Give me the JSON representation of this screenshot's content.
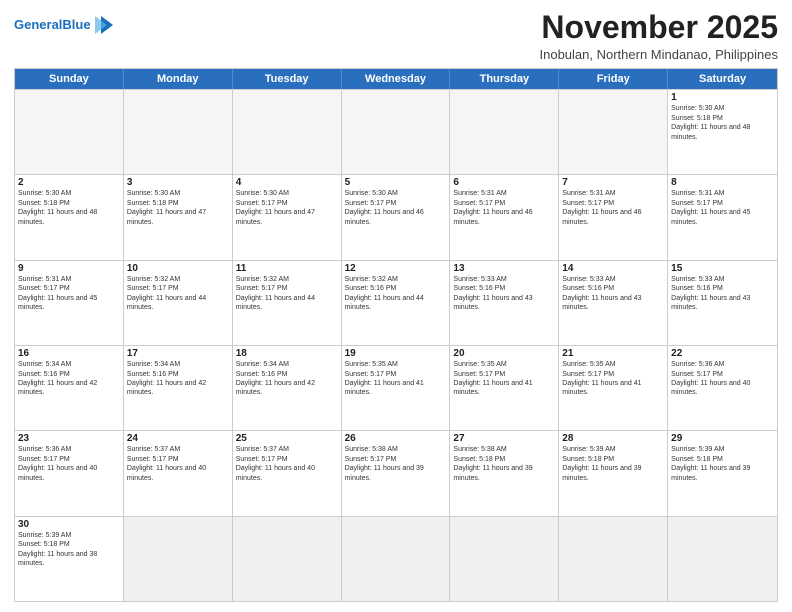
{
  "header": {
    "logo_general": "General",
    "logo_blue": "Blue",
    "month_title": "November 2025",
    "subtitle": "Inobulan, Northern Mindanao, Philippines"
  },
  "days_of_week": [
    "Sunday",
    "Monday",
    "Tuesday",
    "Wednesday",
    "Thursday",
    "Friday",
    "Saturday"
  ],
  "weeks": [
    [
      {
        "day": "",
        "empty": true
      },
      {
        "day": "",
        "empty": true
      },
      {
        "day": "",
        "empty": true
      },
      {
        "day": "",
        "empty": true
      },
      {
        "day": "",
        "empty": true
      },
      {
        "day": "",
        "empty": true
      },
      {
        "day": "1",
        "sunrise": "5:30 AM",
        "sunset": "5:18 PM",
        "daylight": "11 hours and 48 minutes."
      }
    ],
    [
      {
        "day": "2",
        "sunrise": "5:30 AM",
        "sunset": "5:18 PM",
        "daylight": "11 hours and 48 minutes."
      },
      {
        "day": "3",
        "sunrise": "5:30 AM",
        "sunset": "5:18 PM",
        "daylight": "11 hours and 47 minutes."
      },
      {
        "day": "4",
        "sunrise": "5:30 AM",
        "sunset": "5:17 PM",
        "daylight": "11 hours and 47 minutes."
      },
      {
        "day": "5",
        "sunrise": "5:30 AM",
        "sunset": "5:17 PM",
        "daylight": "11 hours and 46 minutes."
      },
      {
        "day": "6",
        "sunrise": "5:31 AM",
        "sunset": "5:17 PM",
        "daylight": "11 hours and 46 minutes."
      },
      {
        "day": "7",
        "sunrise": "5:31 AM",
        "sunset": "5:17 PM",
        "daylight": "11 hours and 46 minutes."
      },
      {
        "day": "8",
        "sunrise": "5:31 AM",
        "sunset": "5:17 PM",
        "daylight": "11 hours and 45 minutes."
      }
    ],
    [
      {
        "day": "9",
        "sunrise": "5:31 AM",
        "sunset": "5:17 PM",
        "daylight": "11 hours and 45 minutes."
      },
      {
        "day": "10",
        "sunrise": "5:32 AM",
        "sunset": "5:17 PM",
        "daylight": "11 hours and 44 minutes."
      },
      {
        "day": "11",
        "sunrise": "5:32 AM",
        "sunset": "5:17 PM",
        "daylight": "11 hours and 44 minutes."
      },
      {
        "day": "12",
        "sunrise": "5:32 AM",
        "sunset": "5:16 PM",
        "daylight": "11 hours and 44 minutes."
      },
      {
        "day": "13",
        "sunrise": "5:33 AM",
        "sunset": "5:16 PM",
        "daylight": "11 hours and 43 minutes."
      },
      {
        "day": "14",
        "sunrise": "5:33 AM",
        "sunset": "5:16 PM",
        "daylight": "11 hours and 43 minutes."
      },
      {
        "day": "15",
        "sunrise": "5:33 AM",
        "sunset": "5:16 PM",
        "daylight": "11 hours and 43 minutes."
      }
    ],
    [
      {
        "day": "16",
        "sunrise": "5:34 AM",
        "sunset": "5:16 PM",
        "daylight": "11 hours and 42 minutes."
      },
      {
        "day": "17",
        "sunrise": "5:34 AM",
        "sunset": "5:16 PM",
        "daylight": "11 hours and 42 minutes."
      },
      {
        "day": "18",
        "sunrise": "5:34 AM",
        "sunset": "5:16 PM",
        "daylight": "11 hours and 42 minutes."
      },
      {
        "day": "19",
        "sunrise": "5:35 AM",
        "sunset": "5:17 PM",
        "daylight": "11 hours and 41 minutes."
      },
      {
        "day": "20",
        "sunrise": "5:35 AM",
        "sunset": "5:17 PM",
        "daylight": "11 hours and 41 minutes."
      },
      {
        "day": "21",
        "sunrise": "5:35 AM",
        "sunset": "5:17 PM",
        "daylight": "11 hours and 41 minutes."
      },
      {
        "day": "22",
        "sunrise": "5:36 AM",
        "sunset": "5:17 PM",
        "daylight": "11 hours and 40 minutes."
      }
    ],
    [
      {
        "day": "23",
        "sunrise": "5:36 AM",
        "sunset": "5:17 PM",
        "daylight": "11 hours and 40 minutes."
      },
      {
        "day": "24",
        "sunrise": "5:37 AM",
        "sunset": "5:17 PM",
        "daylight": "11 hours and 40 minutes."
      },
      {
        "day": "25",
        "sunrise": "5:37 AM",
        "sunset": "5:17 PM",
        "daylight": "11 hours and 40 minutes."
      },
      {
        "day": "26",
        "sunrise": "5:38 AM",
        "sunset": "5:17 PM",
        "daylight": "11 hours and 39 minutes."
      },
      {
        "day": "27",
        "sunrise": "5:38 AM",
        "sunset": "5:18 PM",
        "daylight": "11 hours and 39 minutes."
      },
      {
        "day": "28",
        "sunrise": "5:39 AM",
        "sunset": "5:18 PM",
        "daylight": "11 hours and 39 minutes."
      },
      {
        "day": "29",
        "sunrise": "5:39 AM",
        "sunset": "5:18 PM",
        "daylight": "11 hours and 39 minutes."
      }
    ],
    [
      {
        "day": "30",
        "sunrise": "5:39 AM",
        "sunset": "5:18 PM",
        "daylight": "11 hours and 38 minutes.",
        "has_content": true
      },
      {
        "day": "",
        "empty": true
      },
      {
        "day": "",
        "empty": true
      },
      {
        "day": "",
        "empty": true
      },
      {
        "day": "",
        "empty": true
      },
      {
        "day": "",
        "empty": true
      },
      {
        "day": "",
        "empty": true
      }
    ]
  ]
}
